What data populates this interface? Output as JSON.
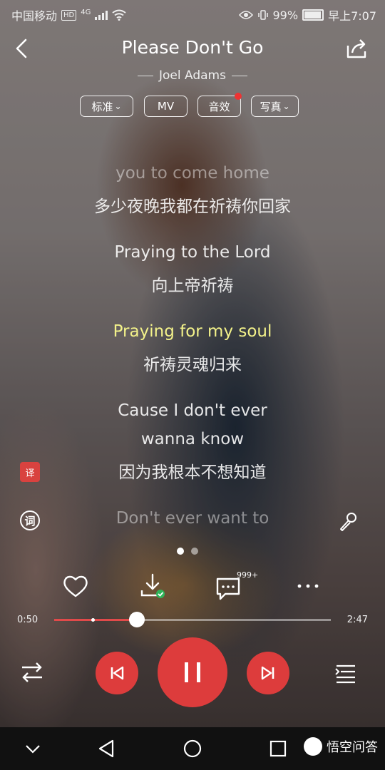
{
  "status": {
    "carrier": "中国移动",
    "hd": "HD",
    "network": "4G",
    "battery": "99%",
    "time": "早上7:07"
  },
  "song": {
    "title": "Please Don't Go",
    "artist": "Joel Adams"
  },
  "pills": {
    "quality": "标准",
    "mv": "MV",
    "effect": "音效",
    "photo": "写真"
  },
  "lyrics": [
    {
      "text": "you to come home"
    },
    {
      "text": "多少夜晚我都在祈祷你回家"
    },
    {
      "text": "Praying to the Lord"
    },
    {
      "text": "向上帝祈祷"
    },
    {
      "text": "Praying for my soul"
    },
    {
      "text": "祈祷灵魂归来"
    },
    {
      "text": "Cause I don't ever"
    },
    {
      "text": "wanna know"
    },
    {
      "text": "因为我根本不想知道"
    },
    {
      "text": "Don't ever want to"
    }
  ],
  "side": {
    "translate_badge": "译",
    "lyric_btn": "词"
  },
  "comments_count": "999+",
  "progress": {
    "current": "0:50",
    "total": "2:47",
    "played_fraction": 0.3,
    "buffered_marker_fraction": 0.14
  },
  "watermark": "悟空问答",
  "colors": {
    "accent": "#dd3c3c",
    "active_lyric": "#f3f28a"
  }
}
